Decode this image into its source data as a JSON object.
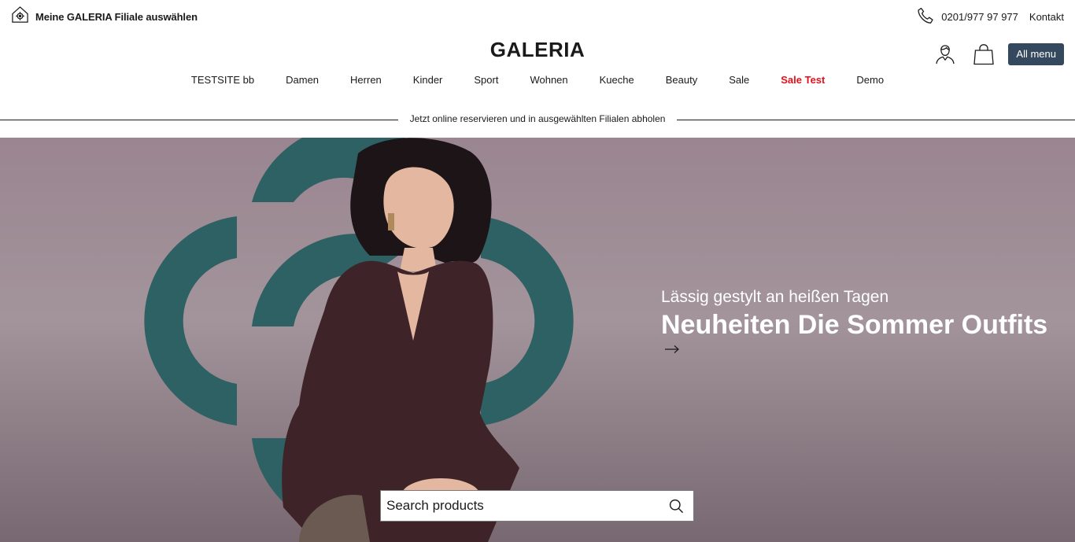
{
  "store_selector": {
    "label": "Meine GALERIA Filiale auswählen",
    "icon": "store-location-icon"
  },
  "contact": {
    "phone": "0201/977 97 977",
    "link": "Kontakt",
    "phone_icon": "phone-icon"
  },
  "brand": {
    "logo": "GALERIA"
  },
  "header_icons": {
    "account": "account-icon",
    "cart": "shopping-bag-icon"
  },
  "all_menu": {
    "label": "All menu"
  },
  "nav": {
    "items": [
      {
        "label": "TESTSITE bb"
      },
      {
        "label": "Damen"
      },
      {
        "label": "Herren"
      },
      {
        "label": "Kinder"
      },
      {
        "label": "Sport"
      },
      {
        "label": "Wohnen"
      },
      {
        "label": "Kueche"
      },
      {
        "label": "Beauty"
      },
      {
        "label": "Sale"
      },
      {
        "label": "Sale Test"
      },
      {
        "label": "Demo"
      }
    ]
  },
  "promo_banner": {
    "text": "Jetzt online reservieren und in ausgewählten Filialen abholen"
  },
  "hero": {
    "subtitle": "Lässig gestylt an heißen Tagen",
    "title": "Neuheiten Die Sommer Outfits",
    "arrow_icon": "arrow-right-icon"
  },
  "search": {
    "placeholder": "Search products",
    "icon": "search-icon"
  },
  "colors": {
    "accent_red": "#e3101b",
    "menu_button": "#34495e",
    "hero_bg": "#9a8590",
    "hero_shape": "#2e6163",
    "outfit": "#3e2428"
  }
}
